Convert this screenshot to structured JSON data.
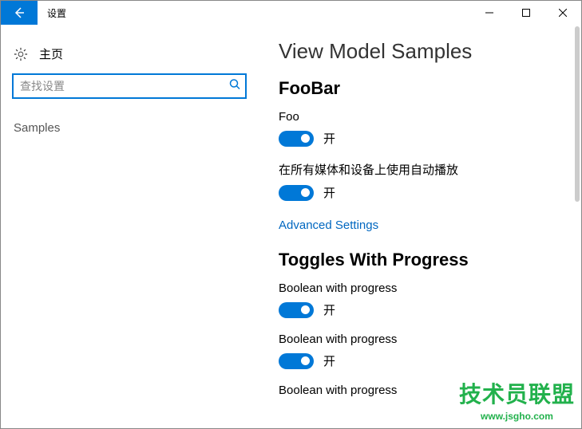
{
  "titlebar": {
    "title": "设置"
  },
  "sidebar": {
    "home_label": "主页",
    "search_placeholder": "查找设置",
    "nav": {
      "samples": "Samples"
    }
  },
  "content": {
    "page_title": "View Model Samples",
    "section_foobar": {
      "title": "FooBar",
      "foo_label": "Foo",
      "foo_state": "开",
      "autoplay_label": "在所有媒体和设备上使用自动播放",
      "autoplay_state": "开",
      "advanced_link": "Advanced Settings"
    },
    "section_toggles": {
      "title": "Toggles With Progress",
      "bool1_label": "Boolean with progress",
      "bool1_state": "开",
      "bool2_label": "Boolean with progress",
      "bool2_state": "开",
      "bool3_label": "Boolean with progress"
    }
  },
  "watermark": {
    "line1": "技术员联盟",
    "line2": "www.jsgho.com"
  }
}
